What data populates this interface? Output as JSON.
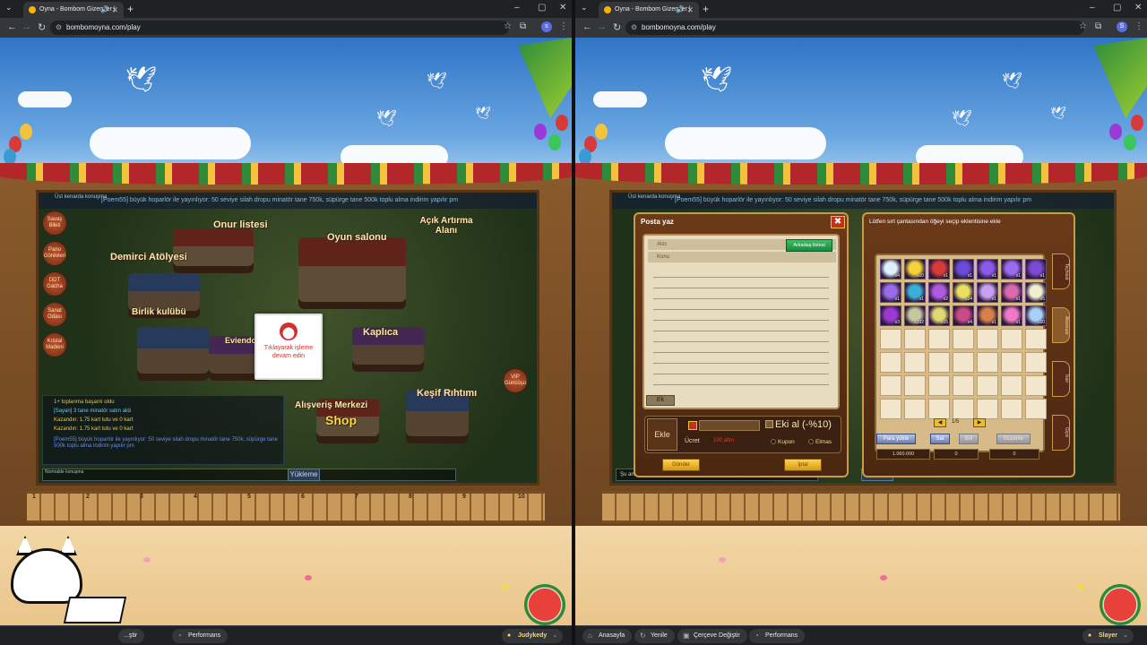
{
  "left": {
    "tab_title": "Oyna - Bombom Gizemler |",
    "url": "bombomoyna.com/play",
    "profile_initial": "s",
    "ticker_tag": "Üst kenarda konuşma",
    "ticker": "[Poem55] büyük hoparlör ile yayınlıyor: 50 seviye silah dropu minatör tane 750k, süpürge tane 500k toplu alma indirim yapılır pm",
    "map_labels": [
      "Onur listesi",
      "Oyun salonu",
      "Açık Artırma Alanı",
      "Demirci Atölyesi",
      "Birlik kulübü",
      "Eviendo",
      "Kaplıca",
      "Keşif Rıhtımı",
      "Alışveriş Merkezi",
      "Shop"
    ],
    "side_buttons": [
      "Savaş Bileti",
      "Pano Görevleri",
      "DDT Gacha",
      "Sanat Odası",
      "Kristal Madeni"
    ],
    "right_badges": [
      "VIP Güncüşü"
    ],
    "chat_lines": [
      "1+ toplanma başarılı oldu",
      "[Sayan] 3 tane minatör satın aldı",
      "Kazandın: 1.75 kart tutu ve 0 kart",
      "Kazandın: 1.75 kart tutu ve 0 kart",
      "[Poem55] büyük hoparlör ile yayınlıyor: 50 seviye silah dropu minatör tane 750k, süpürge tane 500k toplu alma indirim yapılır pm"
    ],
    "chat_input_label": "Normalde konuşma",
    "load_button": "Yükleme",
    "popup_lines": [
      "Tıklayarak işleme",
      "devam edin"
    ],
    "fence_numbers": [
      "1",
      "2",
      "3",
      "4",
      "5",
      "6",
      "7",
      "8",
      "9",
      "10"
    ],
    "bottom": {
      "item1": "...ştir",
      "performans": "Performans",
      "user": "Judykedy"
    }
  },
  "right": {
    "tab_title": "Oyna - Bombom Gizemler |",
    "url": "bombomoyna.com/play",
    "profile_initial": "S",
    "ticker_tag": "Üst kenarda konuşma",
    "ticker": "[Poem55] büyük hoparlör ile yayınlıyor: 50 seviye silah dropu minatör tane 750k, süpürge tane 500k toplu alma indirim yapılır pm",
    "mail": {
      "title": "Posta yaz",
      "close": "✖",
      "recipient_label": "Alıcı",
      "subject_label": "Konu",
      "friends_button": "Arkadaş listesi",
      "ek_button": "Ek",
      "add_button": "Ekle",
      "fee_label": "Ücret",
      "fee_value": "100 altın",
      "ekial_label": "Eki al (-%10)",
      "coupon_label": "Kupon",
      "diamond_label": "Elmas",
      "send_button": "Gönder",
      "cancel_button": "İptal"
    },
    "bag": {
      "title": "Lütfen sırt çantasından öğeyi seçip eklentisine ekle",
      "page": "1/5",
      "para_button": "Para yükle",
      "sat_button": "Sat",
      "btn3": "Böl",
      "btn4": "Düzenle",
      "money1": "1.060.000",
      "money2": "0",
      "money3": "0",
      "side_tabs": [
        "Teçhizat",
        "Aksesuar",
        "İksir",
        "Giysi"
      ],
      "items": [
        {
          "c": "#e0f0ff",
          "q": "x4"
        },
        {
          "c": "#f4d23a",
          "q": "x10"
        },
        {
          "c": "#d83a3a",
          "q": "x1"
        },
        {
          "c": "#6a4ad8",
          "q": "x1"
        },
        {
          "c": "#8a5ae8",
          "q": "x1"
        },
        {
          "c": "#9a6af0",
          "q": "x1"
        },
        {
          "c": "#7a4ad0",
          "q": "x1"
        },
        {
          "c": "#9a6ae8",
          "q": "x1"
        },
        {
          "c": "#3ab0d8",
          "q": "x1"
        },
        {
          "c": "#b05ae0",
          "q": "x2"
        },
        {
          "c": "#e8e060",
          "q": "x24"
        },
        {
          "c": "#c8a0f0",
          "q": "x1"
        },
        {
          "c": "#d86ab0",
          "q": "x1"
        },
        {
          "c": "#f0f0d0",
          "q": "x5"
        },
        {
          "c": "#9a3ad0",
          "q": "x3"
        },
        {
          "c": "#c8c8a0",
          "q": "x392"
        },
        {
          "c": "#e0d870",
          "q": "x15"
        },
        {
          "c": "#c84a8a",
          "q": "x4"
        },
        {
          "c": "#d8804a",
          "q": "x1"
        },
        {
          "c": "#f078c8",
          "q": "x1"
        },
        {
          "c": "#a8d0f8",
          "q": "x10"
        }
      ]
    },
    "chat_input": "Şu anki",
    "load_button": "Yükleme",
    "bottom": {
      "home": "Anasayfa",
      "refresh": "Yenile",
      "frame": "Çerçeve Değiştir",
      "performans": "Performans",
      "user": "Slayer"
    }
  }
}
